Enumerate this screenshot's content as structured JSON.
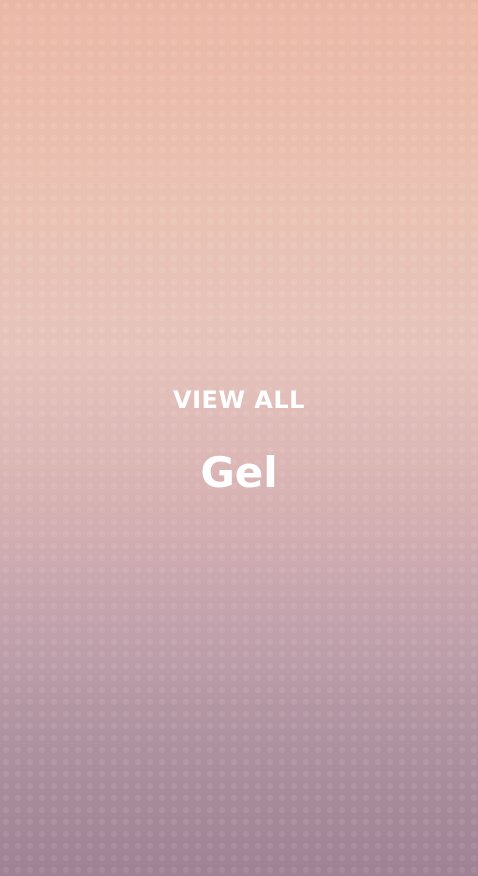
{
  "card": {
    "cta_label": "VIEW ALL",
    "title": "Gel"
  }
}
